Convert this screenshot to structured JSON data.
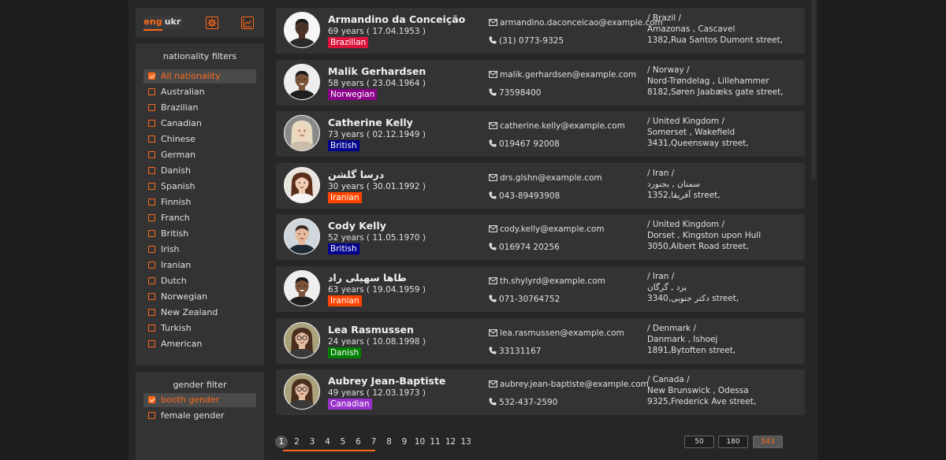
{
  "lang": {
    "eng": "eng",
    "ukr": "ukr"
  },
  "nationality_filter": {
    "title": "nationality filters",
    "options": [
      "All nationality",
      "Australian",
      "Brazilian",
      "Canadian",
      "Chinese",
      "German",
      "Danish",
      "Spanish",
      "Finnish",
      "Franch",
      "British",
      "Irish",
      "Iranian",
      "Dutch",
      "Norwegian",
      "New Zealand",
      "Turkish",
      "American"
    ],
    "selected": "All nationality"
  },
  "gender_filter": {
    "title": "gender filter",
    "options": [
      "booth gender",
      "female gender"
    ],
    "selected": "booth gender"
  },
  "users": [
    {
      "name": "Armandino da Conceição",
      "age": "69 years ( 17.04.1953 )",
      "nat": "Brazilian",
      "nat_color": "#dc143c",
      "email": "armandino.daconceicao@example.com",
      "phone": "(31) 0773-9325",
      "country": "/ Brazil /",
      "region": "Amazonas , Cascavel",
      "street": "1382,Rua Santos Dumont street,",
      "avatar": "man-dark"
    },
    {
      "name": "Malik Gerhardsen",
      "age": "58 years ( 23.04.1964 )",
      "nat": "Norwegian",
      "nat_color": "#8b008b",
      "email": "malik.gerhardsen@example.com",
      "phone": "73598400",
      "country": "/ Norway /",
      "region": "Nord-Trøndelag , Lillehammer",
      "street": "8182,Søren Jaabæks gate street,",
      "avatar": "man-smile"
    },
    {
      "name": "Catherine Kelly",
      "age": "73 years ( 02.12.1949 )",
      "nat": "British",
      "nat_color": "#00008b",
      "email": "catherine.kelly@example.com",
      "phone": "019467 92008",
      "country": "/ United Kingdom /",
      "region": "Somerset , Wakefield",
      "street": "3431,Queensway street,",
      "avatar": "woman-blonde"
    },
    {
      "name": "درسا گلشن",
      "age": "30 years ( 30.01.1992 )",
      "nat": "Iranian",
      "nat_color": "#ff4500",
      "email": "drs.glshn@example.com",
      "phone": "043-89493908",
      "country": "/ Iran /",
      "region": "سمنان , بجنورد",
      "street": "1352,آفریقا street,",
      "avatar": "woman-brown"
    },
    {
      "name": "Cody Kelly",
      "age": "52 years ( 11.05.1970 )",
      "nat": "British",
      "nat_color": "#00008b",
      "email": "cody.kelly@example.com",
      "phone": "016974 20256",
      "country": "/ United Kingdom /",
      "region": "Dorset , Kingston upon Hull",
      "street": "3050,Albert Road street,",
      "avatar": "man-light"
    },
    {
      "name": "طاها سهیلی راد",
      "age": "63 years ( 19.04.1959 )",
      "nat": "Iranian",
      "nat_color": "#ff4500",
      "email": "th.shylyrd@example.com",
      "phone": "071-30764752",
      "country": "/ Iran /",
      "region": "یزد , گرگان",
      "street": "3340,دکتر جنوبی street,",
      "avatar": "man-smile"
    },
    {
      "name": "Lea Rasmussen",
      "age": "24 years ( 10.08.1998 )",
      "nat": "Danish",
      "nat_color": "#008000",
      "email": "lea.rasmussen@example.com",
      "phone": "33131167",
      "country": "/ Denmark /",
      "region": "Danmark , Ishoej",
      "street": "1891,Bytoften street,",
      "avatar": "woman-glasses"
    },
    {
      "name": "Aubrey Jean-Baptiste",
      "age": "49 years ( 12.03.1973 )",
      "nat": "Canadian",
      "nat_color": "#9932cc",
      "email": "aubrey.jean-baptiste@example.com",
      "phone": "532-437-2590",
      "country": "/ Canada /",
      "region": "New Brunswick , Odessa",
      "street": "9325,Frederick Ave street,",
      "avatar": "woman-glasses"
    }
  ],
  "pagination": {
    "pages": [
      "1",
      "2",
      "3",
      "4",
      "5",
      "6",
      "7",
      "8",
      "9",
      "10",
      "11",
      "12",
      "13"
    ],
    "current": "1"
  },
  "page_sizes": [
    "50",
    "180",
    "543"
  ],
  "page_size_selected": "543",
  "colors": {
    "accent": "#ff6a1a",
    "bg": "#1d1d1d",
    "panel": "#262626",
    "card": "#333333"
  }
}
